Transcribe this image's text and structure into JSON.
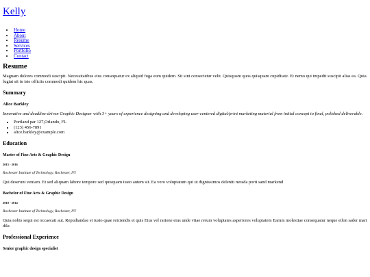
{
  "header": {
    "logo": "Kelly"
  },
  "nav": {
    "items": [
      {
        "label": "Home"
      },
      {
        "label": "About"
      },
      {
        "label": "Resume"
      },
      {
        "label": "Services"
      },
      {
        "label": "Portfolio"
      },
      {
        "label": "Contact"
      }
    ]
  },
  "resume": {
    "title": "Resume",
    "intro": "Magnam dolores commodi suscipit. Necessitatibus eius consequatur ex aliquid fuga eum quidem. Sit sint consectetur velit. Quisquam quos quisquam cupiditate. Et nemo qui impedit suscipit alias ea. Quia fugiat sit in iste officiis commodi quidem hic quas."
  },
  "summary": {
    "title": "Summary",
    "name": "Alice Barkley",
    "tagline": "Innovative and deadline-driven Graphic Designer with 3+ years of experience designing and developing user-centered digital/print marketing material from initial concept to final, polished deliverable.",
    "contact": [
      "Portland par 127,Orlando, FL",
      "(123) 456-7891",
      "alice.barkley@example.com"
    ]
  },
  "education": {
    "title": "Education",
    "entries": [
      {
        "degree": "Master of Fine Arts & Graphic Design",
        "years": "2015 - 2016",
        "school": "Rochester Institute of Technology, Rochester, NY",
        "description": "Qui deserunt veniam. Et sed aliquam labore tempore sed quisquam iusto autem sit. Ea vero voluptatum qui ut dignissimos deleniti nerada porti sand markend"
      },
      {
        "degree": "Bachelor of Fine Arts & Graphic Design",
        "years": "2010 - 2014",
        "school": "Rochester Institute of Technology, Rochester, NY",
        "description": "Quia nobis sequi est occaecati aut. Repudiandae et iusto quae reiciendis et quis Eius vel ratione eius unde vitae rerum voluptates asperiores voluptatem Earum molestiae consequatur neque etlon sader mart dila"
      }
    ]
  },
  "experience": {
    "title": "Professional Experience",
    "first_role": "Senior graphic design specialist"
  },
  "colors": {
    "link": "#0000ee",
    "text": "#000000",
    "background": "#ffffff"
  }
}
